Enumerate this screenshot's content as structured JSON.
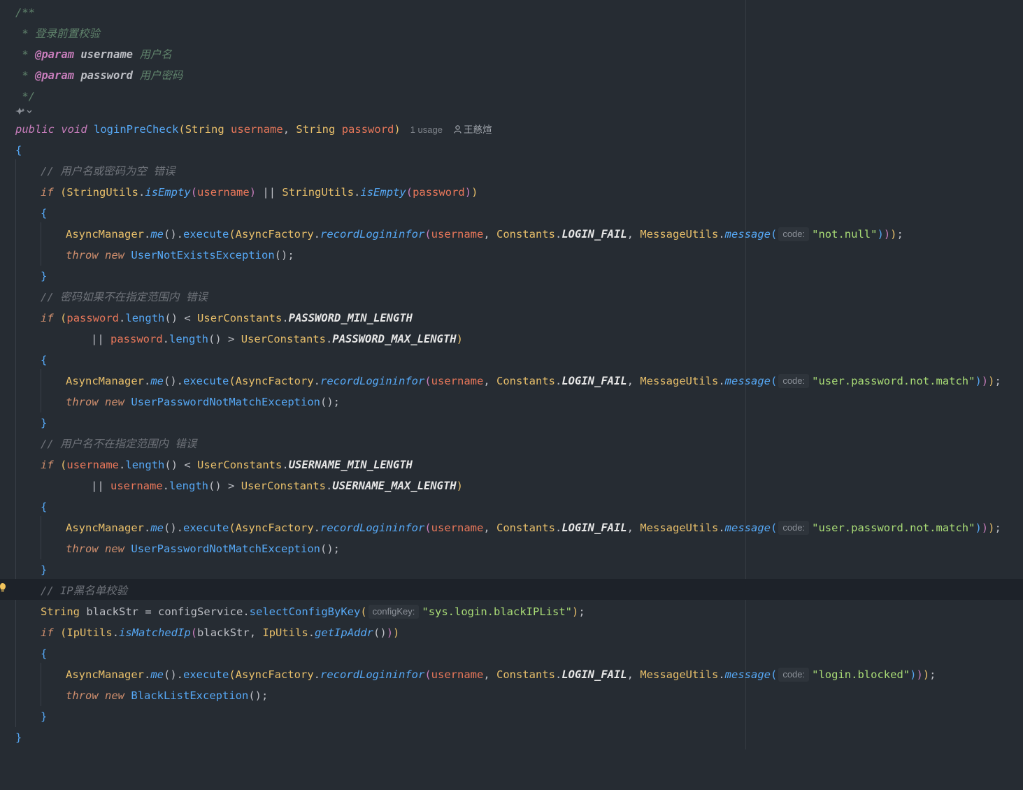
{
  "lines": {
    "l1": "/**",
    "l2_star": " *",
    "l2_text": " 登录前置校验",
    "l3_star": " *",
    "l3_tag": "@param",
    "l3_name": " username",
    "l3_desc": " 用户名",
    "l4_star": " *",
    "l4_tag": "@param",
    "l4_name": " password",
    "l4_desc": " 用户密码",
    "l5": " */",
    "sig_public": "public",
    "sig_void": "void",
    "sig_name": "loginPreCheck",
    "sig_string1": "String",
    "sig_p1": "username",
    "sig_string2": "String",
    "sig_p2": "password",
    "sig_usage": "1 usage",
    "sig_author": "王慈煊",
    "brace_open": "{",
    "brace_close": "}",
    "c1": "// 用户名或密码为空 错误",
    "c2": "// 密码如果不在指定范围内 错误",
    "c3": "// 用户名不在指定范围内 错误",
    "c4": "// IP黑名单校验",
    "if": "if",
    "throw": "throw",
    "new": "new",
    "StringUtils": "StringUtils",
    "isEmpty": "isEmpty",
    "username": "username",
    "password": "password",
    "AsyncManager": "AsyncManager",
    "me": "me",
    "execute": "execute",
    "AsyncFactory": "AsyncFactory",
    "recordLogininfor": "recordLogininfor",
    "Constants": "Constants",
    "LOGIN_FAIL": "LOGIN_FAIL",
    "MessageUtils": "MessageUtils",
    "message": "message",
    "hint_code": "code:",
    "hint_configKey": "configKey:",
    "s_notnull": "\"not.null\"",
    "s_pwd_not_match": "\"user.password.not.match\"",
    "s_login_blocked": "\"login.blocked\"",
    "s_black_ip": "\"sys.login.blackIPList\"",
    "UserNotExistsException": "UserNotExistsException",
    "UserPasswordNotMatchException": "UserPasswordNotMatchException",
    "BlackListException": "BlackListException",
    "length": "length",
    "UserConstants": "UserConstants",
    "PASSWORD_MIN_LENGTH": "PASSWORD_MIN_LENGTH",
    "PASSWORD_MAX_LENGTH": "PASSWORD_MAX_LENGTH",
    "USERNAME_MIN_LENGTH": "USERNAME_MIN_LENGTH",
    "USERNAME_MAX_LENGTH": "USERNAME_MAX_LENGTH",
    "String": "String",
    "blackStr": "blackStr",
    "configService": "configService",
    "selectConfigByKey": "selectConfigByKey",
    "IpUtils": "IpUtils",
    "isMatchedIp": "isMatchedIp",
    "getIpAddr": "getIpAddr"
  },
  "icons": {
    "bulb": "lightbulb-icon",
    "ai": "ai-assistant-icon",
    "author": "person-icon"
  },
  "colors": {
    "background": "#262c33",
    "keyword": "#c77dbb",
    "type": "#e8bf6a",
    "function": "#56a8f5",
    "parameter": "#e8775a",
    "string": "#a9dc76",
    "comment": "#6f737a"
  }
}
